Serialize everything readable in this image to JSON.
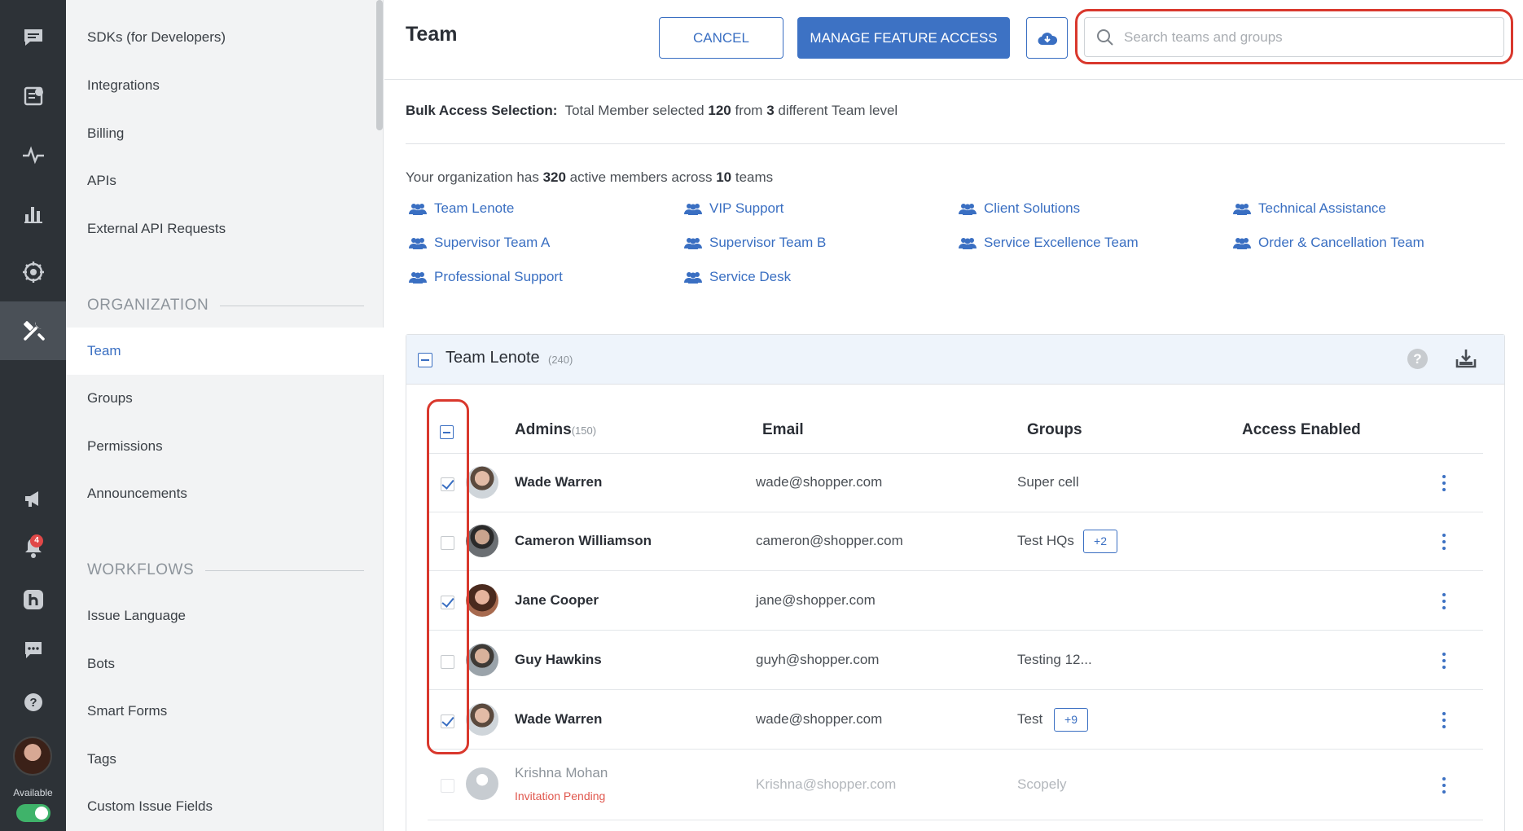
{
  "rail": {
    "items": [
      "chat-icon",
      "help-article-icon",
      "activity-icon",
      "analytics-icon",
      "ai-icon",
      "tools-icon",
      "megaphone-icon",
      "bell-icon",
      "h-logo-icon",
      "message-icon",
      "question-icon"
    ],
    "notification_count": "4",
    "status_label": "Available"
  },
  "sidebar": {
    "top_items": [
      {
        "label": "SDKs (for Developers)"
      },
      {
        "label": "Integrations"
      },
      {
        "label": "Billing"
      },
      {
        "label": "APIs"
      },
      {
        "label": "External API Requests"
      }
    ],
    "organization": {
      "heading": "ORGANIZATION",
      "items": [
        {
          "label": "Team"
        },
        {
          "label": "Groups"
        },
        {
          "label": "Permissions"
        },
        {
          "label": "Announcements"
        }
      ]
    },
    "workflows": {
      "heading": "WORKFLOWS",
      "items": [
        {
          "label": "Issue Language"
        },
        {
          "label": "Bots"
        },
        {
          "label": "Smart Forms"
        },
        {
          "label": "Tags"
        },
        {
          "label": "Custom Issue Fields"
        }
      ]
    }
  },
  "header": {
    "title": "Team",
    "cancel_label": "CANCEL",
    "manage_label": "MANAGE FEATURE ACCESS",
    "search_placeholder": "Search teams and groups"
  },
  "bulk": {
    "label": "Bulk Access Selection:",
    "text_a": "Total Member selected",
    "selected": "120",
    "text_b": "from",
    "levels": "3",
    "text_c": "different Team level"
  },
  "org_summary": {
    "text_a": "Your organization has",
    "members": "320",
    "text_b": "active members across",
    "teams": "10",
    "text_c": "teams"
  },
  "team_links": [
    "Team Lenote",
    "VIP Support",
    "Client Solutions",
    "Technical Assistance",
    "Supervisor Team A",
    "Supervisor Team B",
    "Service Excellence Team",
    "Order & Cancellation Team",
    "Professional Support",
    "Service Desk"
  ],
  "panel": {
    "title": "Team Lenote",
    "count": "(240)",
    "columns": {
      "admins": "Admins",
      "admins_count": "(150)",
      "email": "Email",
      "groups": "Groups",
      "access": "Access Enabled"
    },
    "rows": [
      {
        "name": "Wade Warren",
        "email": "wade@shopper.com",
        "group": "Super cell",
        "extra": "",
        "checked": true
      },
      {
        "name": "Cameron Williamson",
        "email": "cameron@shopper.com",
        "group": "Test HQs",
        "extra": "+2",
        "checked": false
      },
      {
        "name": "Jane Cooper",
        "email": "jane@shopper.com",
        "group": "",
        "extra": "",
        "checked": true
      },
      {
        "name": "Guy Hawkins",
        "email": "guyh@shopper.com",
        "group": "Testing 12...",
        "extra": "",
        "checked": false
      },
      {
        "name": "Wade Warren",
        "email": "wade@shopper.com",
        "group": "Test",
        "extra": "+9",
        "checked": true
      },
      {
        "name": "Krishna Mohan",
        "email": "Krishna@shopper.com",
        "group": "Scopely",
        "extra": "",
        "checked": false,
        "status": "Invitation Pending"
      }
    ]
  },
  "colors": {
    "accent": "#3a6fc2",
    "rail_bg": "#2d3237",
    "highlight": "#d9382d",
    "pending": "#e0574d",
    "available": "#3fb36a"
  }
}
